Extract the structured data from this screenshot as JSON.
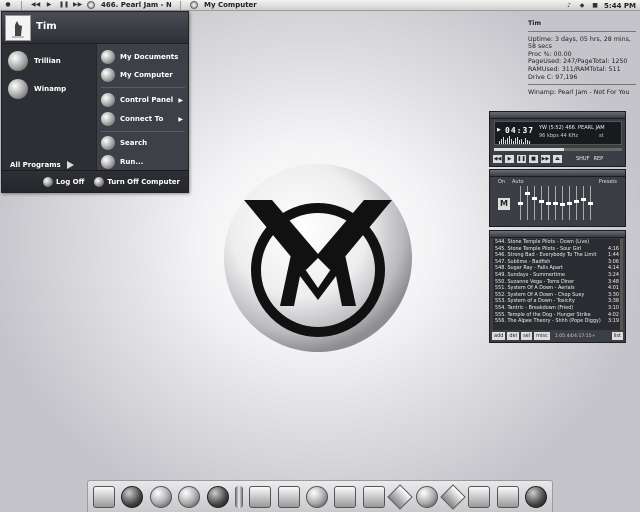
{
  "taskbar": {
    "song": "466. Pearl Jam - No...",
    "window_title": "My Computer",
    "time": "5:44 PM"
  },
  "start_menu": {
    "user": "Tim",
    "pinned": [
      {
        "label": "Trillian",
        "icon": "trillian-icon"
      },
      {
        "label": "Winamp",
        "icon": "winamp-icon"
      }
    ],
    "all_programs": "All Programs",
    "right_items": [
      {
        "label": "My Documents",
        "icon": "documents-icon",
        "sub": false
      },
      {
        "label": "My Computer",
        "icon": "computer-icon",
        "sub": false
      },
      {
        "label": "Control Panel",
        "icon": "control-panel-icon",
        "sub": true
      },
      {
        "label": "Connect To",
        "icon": "network-icon",
        "sub": true
      },
      {
        "label": "Search",
        "icon": "search-icon",
        "sub": false
      },
      {
        "label": "Run...",
        "icon": "run-icon",
        "sub": false
      }
    ],
    "log_off": "Log Off",
    "turn_off": "Turn Off Computer"
  },
  "sysinfo": {
    "name": "Tim",
    "uptime": "Uptime: 3 days, 05 hrs, 28 mins, 58 secs",
    "proc": "Proc %: 00.00",
    "pagefile": "PageUsed: 247/PageTotal: 1250",
    "ram": "RAMUsed: 311/RAMTotal: 511",
    "drive": "Drive C: 97,196",
    "nowplaying": "Winamp: Pearl Jam - Not For You"
  },
  "winamp": {
    "time": "04:37",
    "song": "YW (5:52)  466. PEARL JAM",
    "kbps": "96 kbps   44 KHz",
    "stereo": "st",
    "seek_fraction": 0.55,
    "controls": [
      "◀◀",
      "▶",
      "❚❚",
      "■",
      "▶▶",
      "⏏"
    ],
    "shuffle": "SHUF",
    "repeat": "REP",
    "eq_on": "On",
    "eq_auto": "Auto",
    "eq_presets": "Presets",
    "eq_preset_icon": "M",
    "eq_levels": [
      0.5,
      0.2,
      0.35,
      0.45,
      0.5,
      0.5,
      0.55,
      0.5,
      0.45,
      0.4,
      0.5
    ],
    "playlist": [
      {
        "title": "544. Stone Temple Pilots - Down (Live)",
        "time": ""
      },
      {
        "title": "545. Stone Temple Pilots - Sour Girl",
        "time": "4:16"
      },
      {
        "title": "546. Strong Bad - Everybody To The Limit",
        "time": "1:44"
      },
      {
        "title": "547. Sublime - Badfish",
        "time": "3:06"
      },
      {
        "title": "548. Sugar Ray - Falls Apart",
        "time": "4:14"
      },
      {
        "title": "549. Sundays - Summertime",
        "time": "3:24"
      },
      {
        "title": "550. Suzanne Vega - Toms Diner",
        "time": "3:48"
      },
      {
        "title": "551. System Of A Down - Aerials",
        "time": "4:01"
      },
      {
        "title": "552. System Of A Down - Chop Suey",
        "time": "3:30"
      },
      {
        "title": "553. System of a Down - Toxicity",
        "time": "3:38"
      },
      {
        "title": "554. Tantric - Breakdown (Fried)",
        "time": "3:10"
      },
      {
        "title": "555. Temple of the Dog - Hunger Strike",
        "time": "4:02"
      },
      {
        "title": "556. The Alpee Theory - Shhh (Pope Diggy)",
        "time": "3:19"
      }
    ],
    "pl_buttons": [
      "add",
      "del",
      "sel",
      "misc"
    ],
    "pl_total": "1:05:44/4:17:15+",
    "pl_list_btn": "list"
  },
  "dock": {
    "icons": [
      "finder-icon",
      "m-logo-icon",
      "flower-icon",
      "globe-icon",
      "world-icon",
      "separator-icon",
      "folder-icon",
      "folder-icon",
      "emblem-icon",
      "calculator-icon",
      "camera-icon",
      "paint-icon",
      "skull-icon",
      "cross-icon",
      "tools-icon",
      "drive-icon",
      "trash-icon"
    ]
  },
  "colors": {
    "menu_bg": "#3a3d44",
    "winamp_bg": "#3b3e45"
  }
}
